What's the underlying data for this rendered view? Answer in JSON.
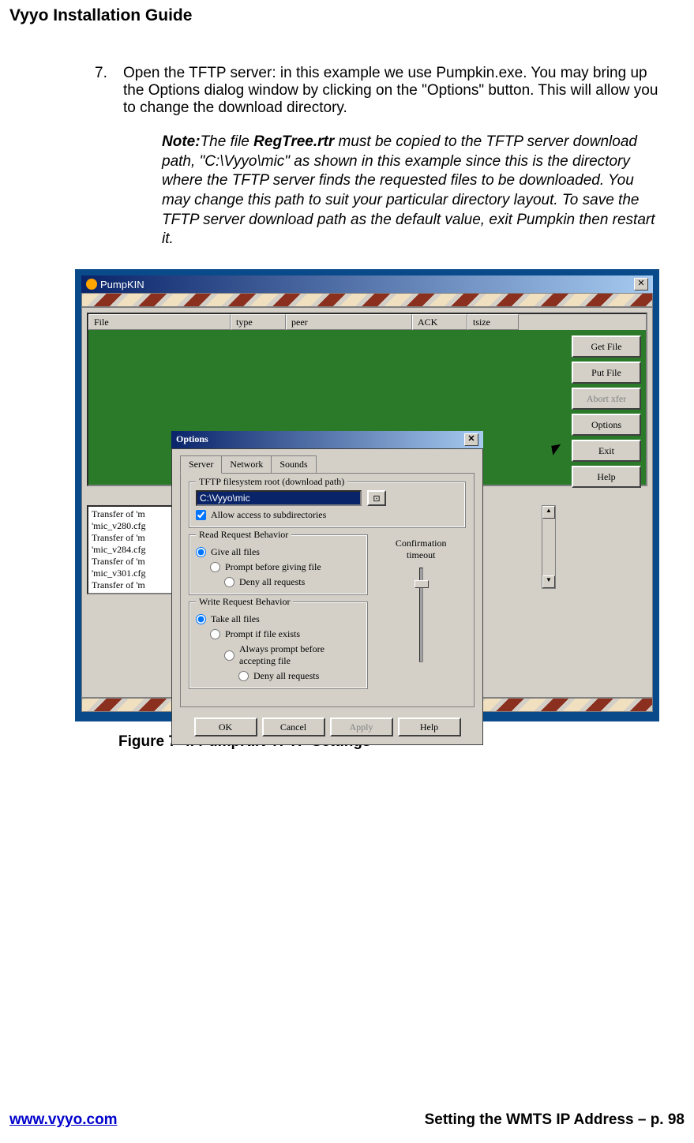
{
  "header": "Vyyo Installation Guide",
  "step": {
    "number": "7.",
    "text": "Open the TFTP server: in this example we use Pumpkin.exe.  You may bring up the Options dialog window by clicking on the \"Options\" button. This will allow you to change the download directory."
  },
  "note": {
    "label": "Note:",
    "pre": "The file ",
    "bold": "RegTree.rtr",
    "post": " must be copied to the TFTP server download path, \"C:\\Vyyo\\mic\" as shown in this example since this is the directory where the TFTP server finds the requested files to be downloaded. You may change this path to suit your particular directory layout. To save the TFTP server download path as the default value, exit Pumpkin then restart it."
  },
  "pumpkin": {
    "title": "PumpKIN",
    "columns": {
      "file": "File",
      "type": "type",
      "peer": "peer",
      "ack": "ACK",
      "tsize": "tsize"
    },
    "buttons": {
      "get": "Get File",
      "put": "Put File",
      "abort": "Abort xfer",
      "options": "Options",
      "exit": "Exit",
      "help": "Help"
    },
    "log": [
      "Transfer of 'm",
      "'mic_v280.cfg",
      "Transfer of 'm",
      "'mic_v284.cfg",
      "Transfer of 'm",
      "'mic_v301.cfg",
      "Transfer of 'm"
    ]
  },
  "options": {
    "title": "Options",
    "tabs": {
      "server": "Server",
      "network": "Network",
      "sounds": "Sounds"
    },
    "tftp_group": "TFTP filesystem root (download path)",
    "path": "C:\\Vyyo\\mic",
    "allow_subdir": "Allow access to subdirectories",
    "read_group": "Read Request Behavior",
    "read": {
      "give_all": "Give all files",
      "prompt": "Prompt before giving file",
      "deny": "Deny all requests"
    },
    "write_group": "Write Request Behavior",
    "write": {
      "take_all": "Take all files",
      "prompt_exists": "Prompt if file exists",
      "always_prompt": "Always prompt before accepting file",
      "deny": "Deny all requests"
    },
    "confirm_label1": "Confirmation",
    "confirm_label2": "timeout",
    "buttons": {
      "ok": "OK",
      "cancel": "Cancel",
      "apply": "Apply",
      "help": "Help"
    }
  },
  "figure_caption": "Figure 7-4. PumpKIN TFTP Settings",
  "footer": {
    "url": "www.vyyo.com",
    "section": "Setting the WMTS IP Address – p. 98"
  }
}
